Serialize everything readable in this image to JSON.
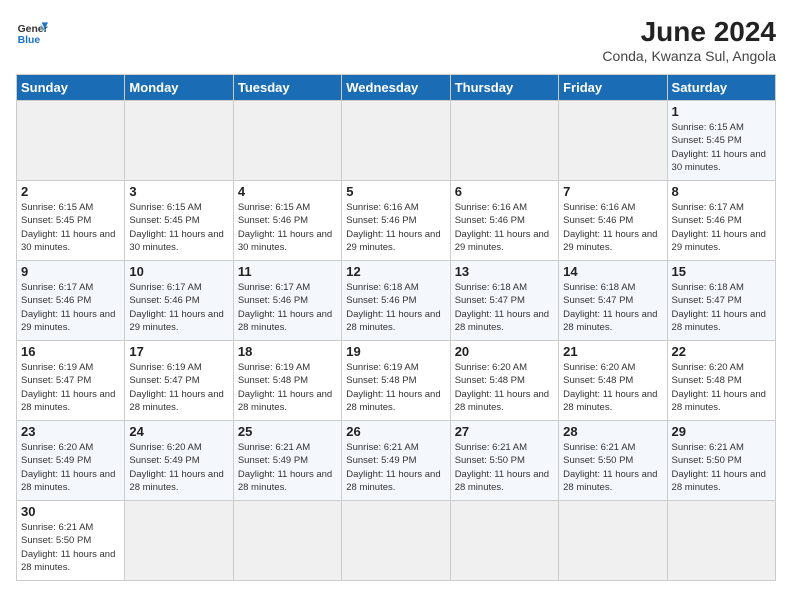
{
  "header": {
    "logo_general": "General",
    "logo_blue": "Blue",
    "title": "June 2024",
    "subtitle": "Conda, Kwanza Sul, Angola"
  },
  "days_of_week": [
    "Sunday",
    "Monday",
    "Tuesday",
    "Wednesday",
    "Thursday",
    "Friday",
    "Saturday"
  ],
  "weeks": [
    {
      "cells": [
        {
          "day": null
        },
        {
          "day": null
        },
        {
          "day": null
        },
        {
          "day": null
        },
        {
          "day": null
        },
        {
          "day": null
        },
        {
          "day": "1",
          "sunrise": "Sunrise: 6:15 AM",
          "sunset": "Sunset: 5:45 PM",
          "daylight": "Daylight: 11 hours and 30 minutes."
        }
      ]
    },
    {
      "cells": [
        {
          "day": "2",
          "sunrise": "Sunrise: 6:15 AM",
          "sunset": "Sunset: 5:45 PM",
          "daylight": "Daylight: 11 hours and 30 minutes."
        },
        {
          "day": "3",
          "sunrise": "Sunrise: 6:15 AM",
          "sunset": "Sunset: 5:45 PM",
          "daylight": "Daylight: 11 hours and 30 minutes."
        },
        {
          "day": "4",
          "sunrise": "Sunrise: 6:15 AM",
          "sunset": "Sunset: 5:46 PM",
          "daylight": "Daylight: 11 hours and 30 minutes."
        },
        {
          "day": "5",
          "sunrise": "Sunrise: 6:16 AM",
          "sunset": "Sunset: 5:46 PM",
          "daylight": "Daylight: 11 hours and 29 minutes."
        },
        {
          "day": "6",
          "sunrise": "Sunrise: 6:16 AM",
          "sunset": "Sunset: 5:46 PM",
          "daylight": "Daylight: 11 hours and 29 minutes."
        },
        {
          "day": "7",
          "sunrise": "Sunrise: 6:16 AM",
          "sunset": "Sunset: 5:46 PM",
          "daylight": "Daylight: 11 hours and 29 minutes."
        },
        {
          "day": "8",
          "sunrise": "Sunrise: 6:17 AM",
          "sunset": "Sunset: 5:46 PM",
          "daylight": "Daylight: 11 hours and 29 minutes."
        }
      ]
    },
    {
      "cells": [
        {
          "day": "9",
          "sunrise": "Sunrise: 6:17 AM",
          "sunset": "Sunset: 5:46 PM",
          "daylight": "Daylight: 11 hours and 29 minutes."
        },
        {
          "day": "10",
          "sunrise": "Sunrise: 6:17 AM",
          "sunset": "Sunset: 5:46 PM",
          "daylight": "Daylight: 11 hours and 29 minutes."
        },
        {
          "day": "11",
          "sunrise": "Sunrise: 6:17 AM",
          "sunset": "Sunset: 5:46 PM",
          "daylight": "Daylight: 11 hours and 28 minutes."
        },
        {
          "day": "12",
          "sunrise": "Sunrise: 6:18 AM",
          "sunset": "Sunset: 5:46 PM",
          "daylight": "Daylight: 11 hours and 28 minutes."
        },
        {
          "day": "13",
          "sunrise": "Sunrise: 6:18 AM",
          "sunset": "Sunset: 5:47 PM",
          "daylight": "Daylight: 11 hours and 28 minutes."
        },
        {
          "day": "14",
          "sunrise": "Sunrise: 6:18 AM",
          "sunset": "Sunset: 5:47 PM",
          "daylight": "Daylight: 11 hours and 28 minutes."
        },
        {
          "day": "15",
          "sunrise": "Sunrise: 6:18 AM",
          "sunset": "Sunset: 5:47 PM",
          "daylight": "Daylight: 11 hours and 28 minutes."
        }
      ]
    },
    {
      "cells": [
        {
          "day": "16",
          "sunrise": "Sunrise: 6:19 AM",
          "sunset": "Sunset: 5:47 PM",
          "daylight": "Daylight: 11 hours and 28 minutes."
        },
        {
          "day": "17",
          "sunrise": "Sunrise: 6:19 AM",
          "sunset": "Sunset: 5:47 PM",
          "daylight": "Daylight: 11 hours and 28 minutes."
        },
        {
          "day": "18",
          "sunrise": "Sunrise: 6:19 AM",
          "sunset": "Sunset: 5:48 PM",
          "daylight": "Daylight: 11 hours and 28 minutes."
        },
        {
          "day": "19",
          "sunrise": "Sunrise: 6:19 AM",
          "sunset": "Sunset: 5:48 PM",
          "daylight": "Daylight: 11 hours and 28 minutes."
        },
        {
          "day": "20",
          "sunrise": "Sunrise: 6:20 AM",
          "sunset": "Sunset: 5:48 PM",
          "daylight": "Daylight: 11 hours and 28 minutes."
        },
        {
          "day": "21",
          "sunrise": "Sunrise: 6:20 AM",
          "sunset": "Sunset: 5:48 PM",
          "daylight": "Daylight: 11 hours and 28 minutes."
        },
        {
          "day": "22",
          "sunrise": "Sunrise: 6:20 AM",
          "sunset": "Sunset: 5:48 PM",
          "daylight": "Daylight: 11 hours and 28 minutes."
        }
      ]
    },
    {
      "cells": [
        {
          "day": "23",
          "sunrise": "Sunrise: 6:20 AM",
          "sunset": "Sunset: 5:49 PM",
          "daylight": "Daylight: 11 hours and 28 minutes."
        },
        {
          "day": "24",
          "sunrise": "Sunrise: 6:20 AM",
          "sunset": "Sunset: 5:49 PM",
          "daylight": "Daylight: 11 hours and 28 minutes."
        },
        {
          "day": "25",
          "sunrise": "Sunrise: 6:21 AM",
          "sunset": "Sunset: 5:49 PM",
          "daylight": "Daylight: 11 hours and 28 minutes."
        },
        {
          "day": "26",
          "sunrise": "Sunrise: 6:21 AM",
          "sunset": "Sunset: 5:49 PM",
          "daylight": "Daylight: 11 hours and 28 minutes."
        },
        {
          "day": "27",
          "sunrise": "Sunrise: 6:21 AM",
          "sunset": "Sunset: 5:50 PM",
          "daylight": "Daylight: 11 hours and 28 minutes."
        },
        {
          "day": "28",
          "sunrise": "Sunrise: 6:21 AM",
          "sunset": "Sunset: 5:50 PM",
          "daylight": "Daylight: 11 hours and 28 minutes."
        },
        {
          "day": "29",
          "sunrise": "Sunrise: 6:21 AM",
          "sunset": "Sunset: 5:50 PM",
          "daylight": "Daylight: 11 hours and 28 minutes."
        }
      ]
    },
    {
      "cells": [
        {
          "day": "30",
          "sunrise": "Sunrise: 6:21 AM",
          "sunset": "Sunset: 5:50 PM",
          "daylight": "Daylight: 11 hours and 28 minutes."
        },
        {
          "day": null
        },
        {
          "day": null
        },
        {
          "day": null
        },
        {
          "day": null
        },
        {
          "day": null
        },
        {
          "day": null
        }
      ]
    }
  ]
}
